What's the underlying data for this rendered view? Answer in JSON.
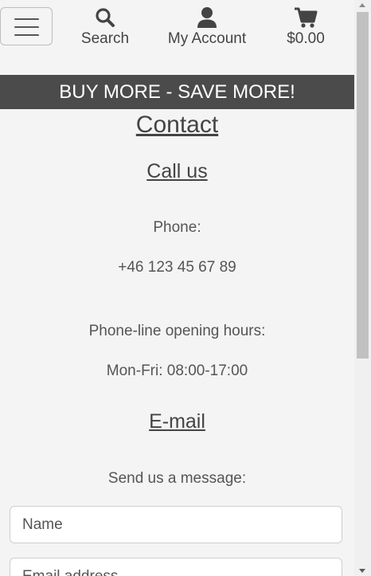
{
  "header": {
    "nav": [
      {
        "label": "Search",
        "icon": "search-icon"
      },
      {
        "label": "My Account",
        "icon": "user-icon"
      },
      {
        "label": "$0.00",
        "icon": "cart-icon"
      }
    ]
  },
  "banner": {
    "text": "BUY MORE - SAVE MORE!"
  },
  "contact": {
    "title": "Contact",
    "call": {
      "heading": "Call us",
      "phone_label": "Phone:",
      "phone_number": "+46 123 45 67 89",
      "hours_label": "Phone-line opening hours:",
      "hours_value": "Mon-Fri: 08:00-17:00"
    },
    "email": {
      "heading": "E-mail",
      "intro": "Send us a message:"
    },
    "form": {
      "name_placeholder": "Name",
      "email_placeholder": "Email address"
    }
  },
  "colors": {
    "banner_bg": "#4b4b4b",
    "page_bg": "#f4f4f4",
    "text": "#555555"
  }
}
